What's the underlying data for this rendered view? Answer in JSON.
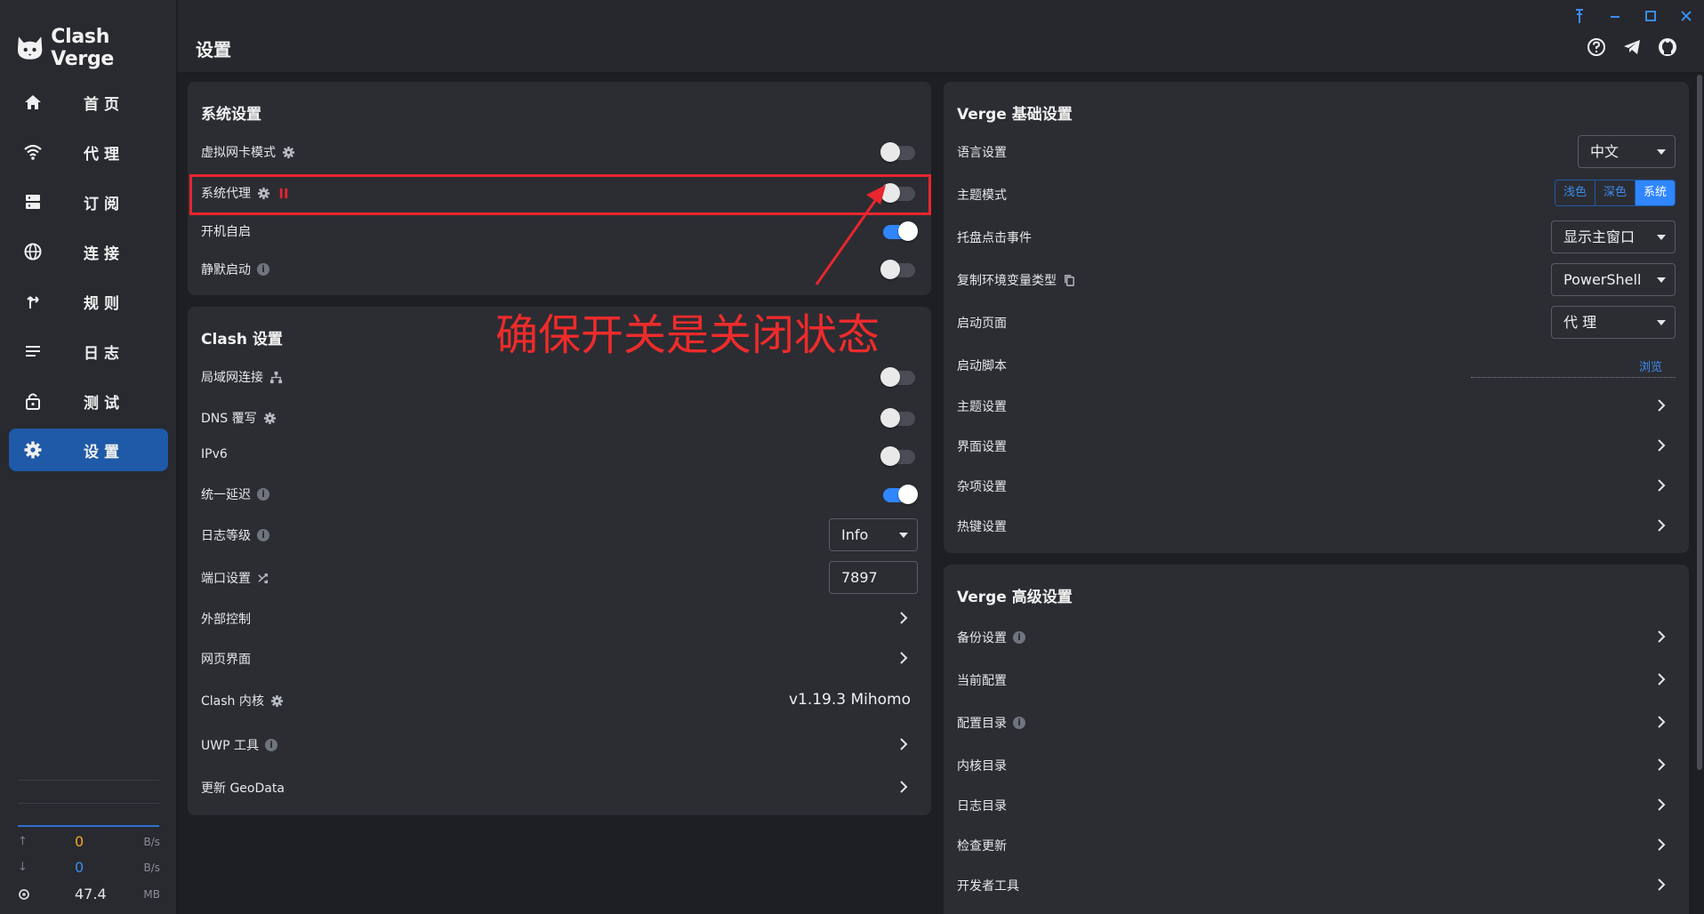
{
  "app": {
    "name": "Clash Verge"
  },
  "header": {
    "title": "设置"
  },
  "colors": {
    "accent": "#2f86ff",
    "active_nav": "#1e5aa8",
    "annotation": "#e8262e",
    "upload": "#f5a623",
    "download": "#3d8cf0"
  },
  "sidebar": {
    "items": [
      {
        "label": "首页",
        "icon": "home-icon"
      },
      {
        "label": "代理",
        "icon": "wifi-icon"
      },
      {
        "label": "订阅",
        "icon": "server-icon"
      },
      {
        "label": "连接",
        "icon": "globe-icon"
      },
      {
        "label": "规则",
        "icon": "fork-arrow-icon"
      },
      {
        "label": "日志",
        "icon": "list-icon"
      },
      {
        "label": "测试",
        "icon": "lock-icon"
      },
      {
        "label": "设置",
        "icon": "gear-icon",
        "active": true
      }
    ],
    "traffic": {
      "upload": {
        "value": "0",
        "unit": "B/s"
      },
      "download": {
        "value": "0",
        "unit": "B/s"
      },
      "memory": {
        "value": "47.4",
        "unit": "MB"
      }
    }
  },
  "system_settings": {
    "title": "系统设置",
    "tun_mode": {
      "label": "虚拟网卡模式",
      "enabled": false
    },
    "system_proxy": {
      "label": "系统代理",
      "enabled": false
    },
    "auto_launch": {
      "label": "开机自启",
      "enabled": true
    },
    "silent_start": {
      "label": "静默启动",
      "enabled": false
    }
  },
  "clash_settings": {
    "title": "Clash 设置",
    "lan": {
      "label": "局域网连接",
      "enabled": false
    },
    "dns": {
      "label": "DNS 覆写",
      "enabled": false
    },
    "ipv6": {
      "label": "IPv6",
      "enabled": false
    },
    "unified_delay": {
      "label": "统一延迟",
      "enabled": true
    },
    "log_level": {
      "label": "日志等级",
      "value": "Info"
    },
    "port": {
      "label": "端口设置",
      "value": "7897"
    },
    "external_control": {
      "label": "外部控制"
    },
    "web_ui": {
      "label": "网页界面"
    },
    "core": {
      "label": "Clash 内核",
      "value": "v1.19.3 Mihomo"
    },
    "uwp": {
      "label": "UWP 工具"
    },
    "geodata": {
      "label": "更新 GeoData"
    }
  },
  "verge_basic": {
    "title": "Verge 基础设置",
    "language": {
      "label": "语言设置",
      "value": "中文"
    },
    "theme_mode": {
      "label": "主题模式",
      "options": [
        "浅色",
        "深色",
        "系统"
      ],
      "selected": "系统"
    },
    "tray_click": {
      "label": "托盘点击事件",
      "value": "显示主窗口"
    },
    "copy_env": {
      "label": "复制环境变量类型",
      "value": "PowerShell"
    },
    "start_page": {
      "label": "启动页面",
      "value": "代 理"
    },
    "start_script": {
      "label": "启动脚本",
      "action": "浏览"
    },
    "theme_settings": {
      "label": "主题设置"
    },
    "layout_settings": {
      "label": "界面设置"
    },
    "misc_settings": {
      "label": "杂项设置"
    },
    "hotkey_settings": {
      "label": "热键设置"
    }
  },
  "verge_advanced": {
    "title": "Verge 高级设置",
    "items": [
      {
        "label": "备份设置",
        "info": true
      },
      {
        "label": "当前配置",
        "info": false
      },
      {
        "label": "配置目录",
        "info": true
      },
      {
        "label": "内核目录",
        "info": false
      },
      {
        "label": "日志目录",
        "info": false
      },
      {
        "label": "检查更新",
        "info": false
      },
      {
        "label": "开发者工具",
        "info": false
      }
    ]
  },
  "annotation": {
    "text": "确保开关是关闭状态"
  }
}
